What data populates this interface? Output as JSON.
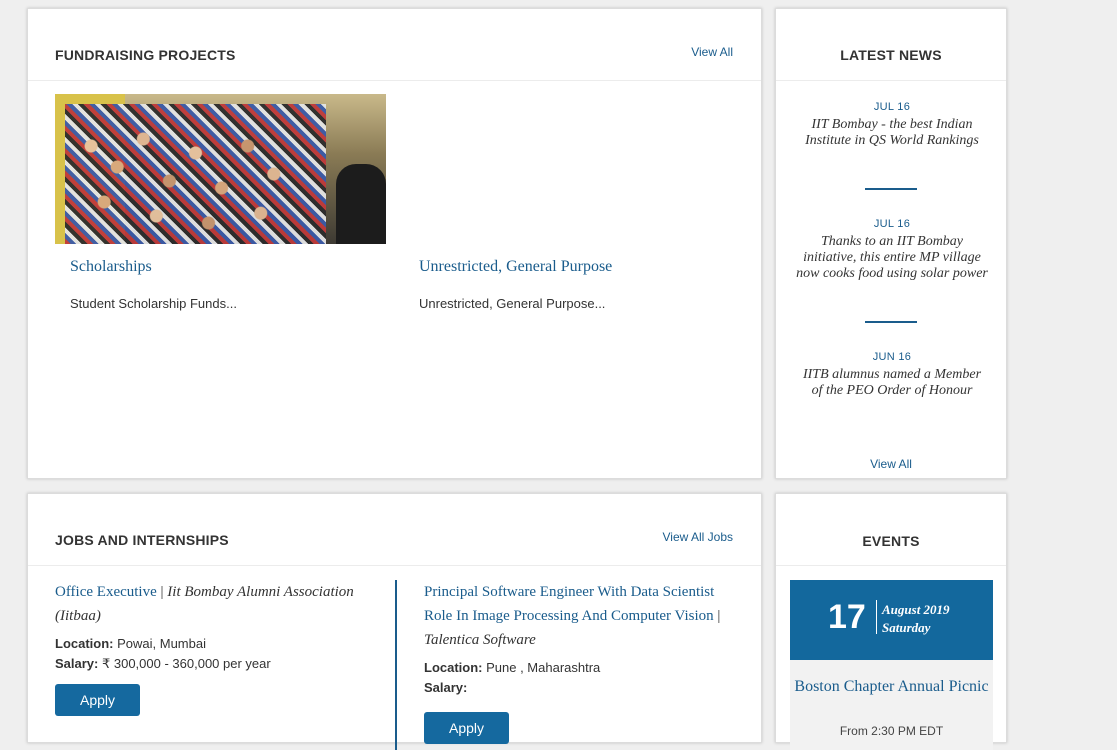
{
  "fundraising": {
    "title": "FUNDRAISING PROJECTS",
    "view_all": "View All",
    "projects": [
      {
        "title": "Scholarships",
        "desc": "Student Scholarship Funds..."
      },
      {
        "title": "Unrestricted, General Purpose",
        "desc": "Unrestricted, General Purpose..."
      }
    ]
  },
  "news": {
    "title": "LATEST NEWS",
    "view_all": "View All",
    "items": [
      {
        "date": "JUL 16",
        "text": "IIT Bombay - the best Indian Institute in QS World Rankings"
      },
      {
        "date": "JUL 16",
        "text": "Thanks to an IIT Bombay initiative, this entire MP village now cooks food using solar power"
      },
      {
        "date": "JUN 16",
        "text": "IITB alumnus named a Member of the PEO Order of Honour"
      }
    ]
  },
  "jobs": {
    "title": "JOBS AND INTERNSHIPS",
    "view_all": "View All Jobs",
    "items": [
      {
        "role": "Office Executive",
        "sep": " | ",
        "company": "Iit Bombay Alumni Association (Iitbaa)",
        "location_label": "Location:",
        "location": " Powai, Mumbai",
        "salary_label": "Salary:",
        "salary": " ₹ 300,000 - 360,000 per year",
        "apply": "Apply"
      },
      {
        "role": "Principal Software Engineer With Data Scientist Role In Image Processing And Computer Vision",
        "sep": " | ",
        "company": "Talentica Software",
        "location_label": "Location:",
        "location": " Pune , Maharashtra",
        "salary_label": "Salary:",
        "salary": "",
        "apply": "Apply"
      }
    ]
  },
  "events": {
    "title": "EVENTS",
    "day": "17",
    "month_year": "August 2019",
    "weekday": "Saturday",
    "event_title": "Boston Chapter Annual Picnic",
    "time": "From 2:30 PM EDT"
  },
  "colors": {
    "accent": "#1a5c8c",
    "button": "#15699f",
    "event_banner": "#13689d"
  }
}
